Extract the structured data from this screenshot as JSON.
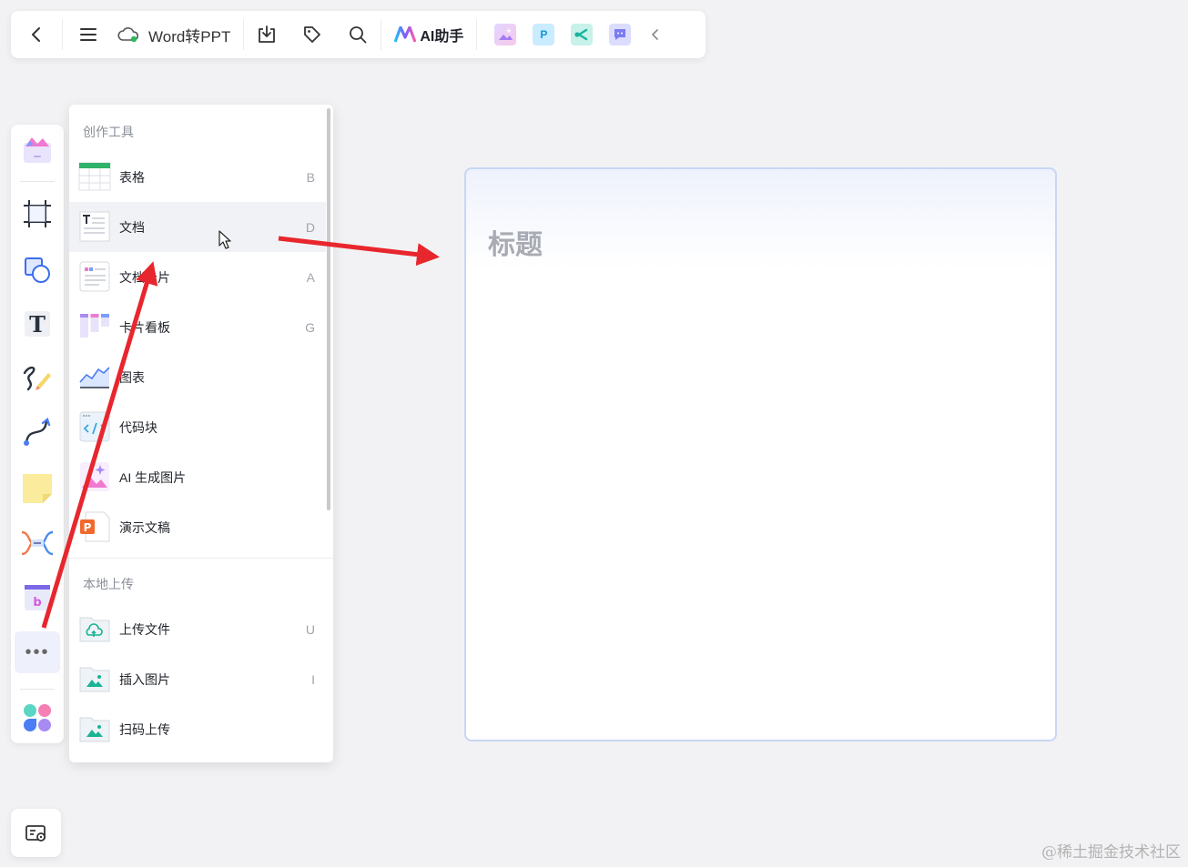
{
  "toolbar": {
    "doc_title": "Word转PPT",
    "ai_label": "AI助手",
    "app_p_label": "P"
  },
  "panel": {
    "section_create": "创作工具",
    "section_upload": "本地上传",
    "items": [
      {
        "label": "表格",
        "key": "B"
      },
      {
        "label": "文档",
        "key": "D"
      },
      {
        "label": "文档卡片",
        "key": "A"
      },
      {
        "label": "卡片看板",
        "key": "G"
      },
      {
        "label": "图表",
        "key": ""
      },
      {
        "label": "代码块",
        "key": ""
      },
      {
        "label": "AI 生成图片",
        "key": ""
      },
      {
        "label": "演示文稿",
        "key": ""
      }
    ],
    "upload_items": [
      {
        "label": "上传文件",
        "key": "U"
      },
      {
        "label": "插入图片",
        "key": "I"
      },
      {
        "label": "扫码上传",
        "key": ""
      }
    ]
  },
  "lefttool": {
    "text_tool_glyph": "T",
    "more_glyph": "•••",
    "timeline_glyph": "b"
  },
  "card": {
    "title": "标题"
  },
  "watermark": "@稀土掘金技术社区",
  "colors": {
    "arrow": "#e8262d",
    "card_border": "#c8d6f5",
    "hover_bg": "#f1f2f5"
  }
}
